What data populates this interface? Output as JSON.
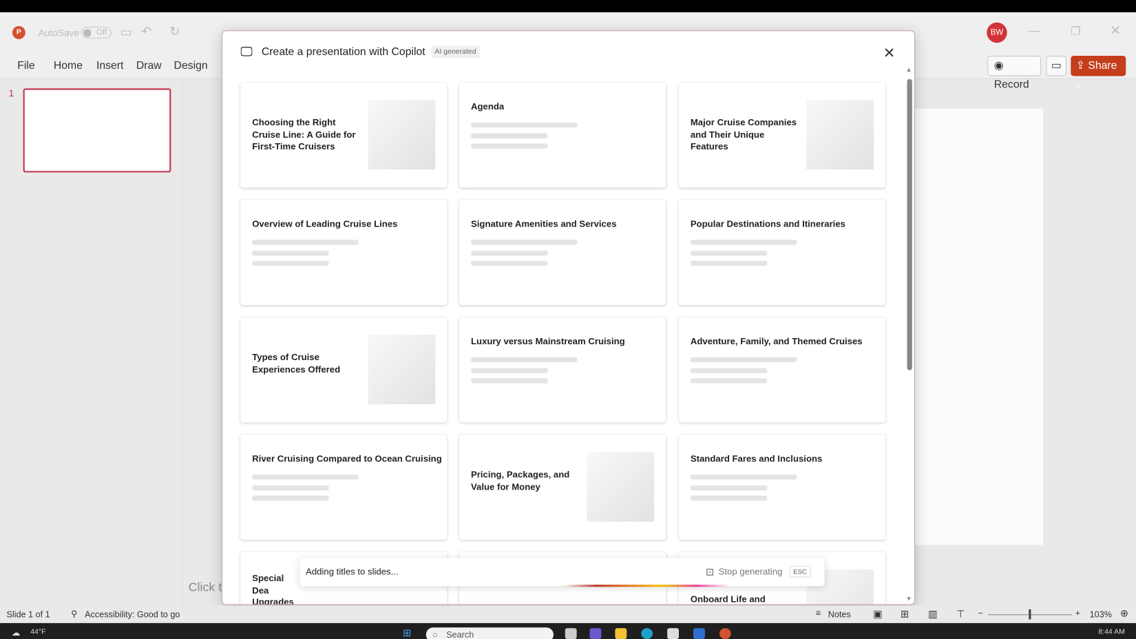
{
  "app": {
    "autosave_label": "AutoSave",
    "autosave_state": "Off",
    "avatar_initials": "BW",
    "record_label": "Record",
    "share_label": "Share"
  },
  "ribbon": {
    "tabs": [
      "File",
      "Home",
      "Insert",
      "Draw",
      "Design"
    ]
  },
  "thumbnail": {
    "number": "1"
  },
  "canvas": {
    "placeholder_text": "Click t"
  },
  "dialog": {
    "title": "Create a presentation with Copilot",
    "badge": "AI generated",
    "cards": [
      {
        "title": "Choosing the Right Cruise Line: A Guide for First-Time Cruisers",
        "image": true
      },
      {
        "title": "Agenda",
        "image": false
      },
      {
        "title": "Major Cruise Companies and Their Unique Features",
        "image": true
      },
      {
        "title": "Overview of Leading Cruise Lines",
        "image": false
      },
      {
        "title": "Signature Amenities and Services",
        "image": false
      },
      {
        "title": "Popular Destinations and Itineraries",
        "image": false
      },
      {
        "title": "Types of Cruise Experiences Offered",
        "image": true
      },
      {
        "title": "Luxury versus Mainstream Cruising",
        "image": false
      },
      {
        "title": "Adventure, Family, and Themed Cruises",
        "image": false
      },
      {
        "title": "River Cruising Compared to Ocean Cruising",
        "image": false
      },
      {
        "title": "Pricing, Packages, and Value for Money",
        "image": true
      },
      {
        "title": "Standard Fares and Inclusions",
        "image": false
      },
      {
        "title": "Special Dea Upgrades",
        "image": false
      },
      {
        "title": "",
        "image": false
      },
      {
        "title": "Onboard Life and",
        "image": true
      }
    ],
    "progress_text": "Adding titles to slides...",
    "stop_label": "Stop generating",
    "esc_label": "ESC"
  },
  "status": {
    "slide": "Slide 1 of 1",
    "accessibility": "Accessibility: Good to go",
    "notes": "Notes",
    "zoom": "103%"
  },
  "taskbar": {
    "weather": "44°F",
    "search": "Search",
    "time": "8:44 AM"
  }
}
